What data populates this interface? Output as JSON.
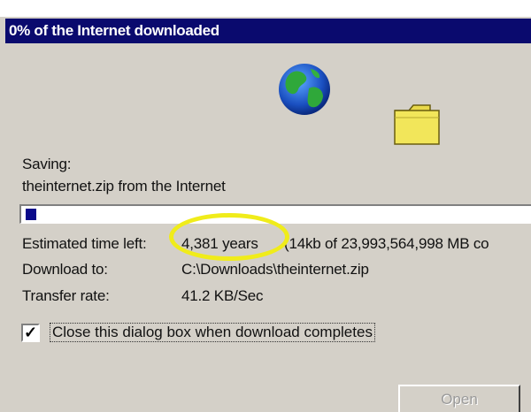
{
  "window": {
    "title": "0% of the Internet downloaded"
  },
  "status": {
    "saving_label": "Saving:",
    "source": "theinternet.zip from the Internet"
  },
  "progress": {
    "fraction": 0.0
  },
  "details": {
    "estimated_label": "Estimated time left:",
    "estimated_value": "4,381 years",
    "estimated_extra": "(14kb of 23,993,564,998 MB co",
    "download_to_label": "Download to:",
    "download_to_value": "C:\\Downloads\\theinternet.zip",
    "transfer_rate_label": "Transfer rate:",
    "transfer_rate_value": "41.2 KB/Sec"
  },
  "options": {
    "close_when_done_label": "Close this dialog box when download completes",
    "close_when_done_checked": true,
    "check_glyph": "✓"
  },
  "buttons": {
    "open_label": "Open"
  },
  "colors": {
    "titlebar": "#0a0a6e",
    "progress_fill": "#0a0a8a",
    "highlight": "#f0ec1a",
    "dialog_bg": "#d4d0c8"
  },
  "icons": [
    "globe-icon",
    "folder-icon",
    "checkmark-icon"
  ]
}
